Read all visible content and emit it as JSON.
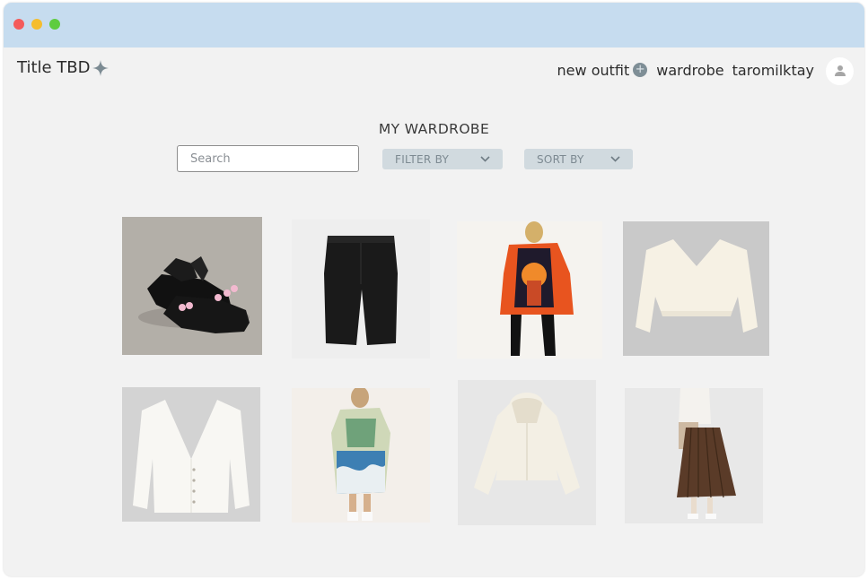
{
  "window": {
    "traffic_lights": [
      "close",
      "minimize",
      "zoom"
    ]
  },
  "header": {
    "brand": "Title TBD",
    "brand_icon": "sparkle-icon",
    "nav": {
      "new_outfit": "new outfit",
      "new_outfit_icon": "+",
      "wardrobe": "wardrobe",
      "username": "taromilktay"
    },
    "avatar_icon": "user-icon"
  },
  "main": {
    "title": "MY WARDROBE",
    "search": {
      "placeholder": "Search",
      "value": ""
    },
    "filter": {
      "label": "FILTER BY"
    },
    "sort": {
      "label": "SORT BY"
    },
    "items": [
      {
        "name": "black platform sandals with pink hearts"
      },
      {
        "name": "black pants"
      },
      {
        "name": "orange printed oversized shirt"
      },
      {
        "name": "cream v-neck cropped sweater"
      },
      {
        "name": "white cardigan"
      },
      {
        "name": "wave print t-shirt dress"
      },
      {
        "name": "cream cropped hoodie"
      },
      {
        "name": "brown pleated skirt"
      }
    ]
  },
  "colors": {
    "titlebar": "#c6dcef",
    "background": "#f2f2f2",
    "button_bg": "#d1dadf",
    "button_text": "#7d8a92"
  }
}
